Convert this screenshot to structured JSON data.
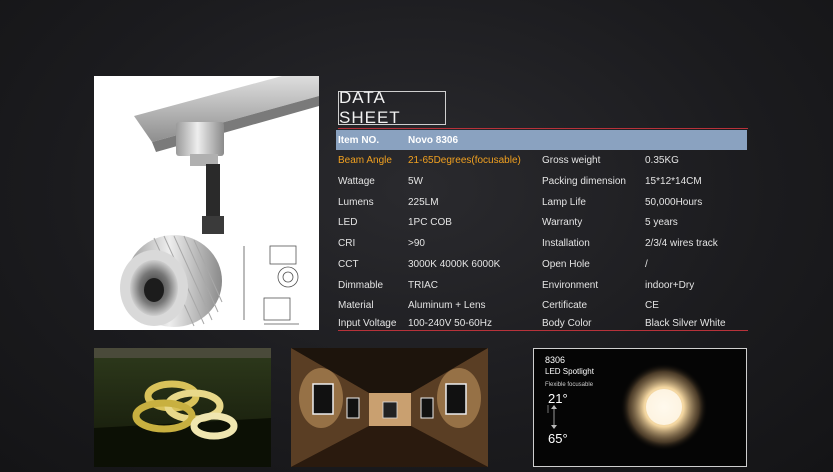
{
  "sheet": {
    "title": "DATA SHEET",
    "header": {
      "label": "Item NO.",
      "value": "Novo 8306"
    },
    "rows": [
      {
        "k1": "Beam Angle",
        "v1": "21-65Degrees(focusable)",
        "k2": "Gross weight",
        "v2": "0.35KG"
      },
      {
        "k1": "Wattage",
        "v1": "5W",
        "k2": "Packing dimension",
        "v2": "15*12*14CM"
      },
      {
        "k1": "Lumens",
        "v1": "225LM",
        "k2": "Lamp Life",
        "v2": "50,000Hours"
      },
      {
        "k1": "LED",
        "v1": "1PC COB",
        "k2": "Warranty",
        "v2": "5 years"
      },
      {
        "k1": "CRI",
        "v1": ">90",
        "k2": "Installation",
        "v2": "2/3/4 wires track"
      },
      {
        "k1": "CCT",
        "v1": "3000K 4000K 6000K",
        "k2": "Open Hole",
        "v2": "/"
      },
      {
        "k1": "Dimmable",
        "v1": "TRIAC",
        "k2": "Environment",
        "v2": "indoor+Dry"
      },
      {
        "k1": "Material",
        "v1": "Aluminum + Lens",
        "k2": "Certificate",
        "v2": "CE"
      },
      {
        "k1": "Input Voltage",
        "v1": "100-240V 50-60Hz",
        "k2": "Body Color",
        "v2": "Black Silver White"
      }
    ]
  },
  "spotlight_card": {
    "model": "8306",
    "name": "LED Spotlight",
    "feature": "Flexible focusable",
    "angle_min": "21°",
    "angle_max": "65°"
  },
  "colors": {
    "accent_line": "#b7323a",
    "header_bg": "#8aa2c0",
    "highlight": "#f0a020"
  }
}
